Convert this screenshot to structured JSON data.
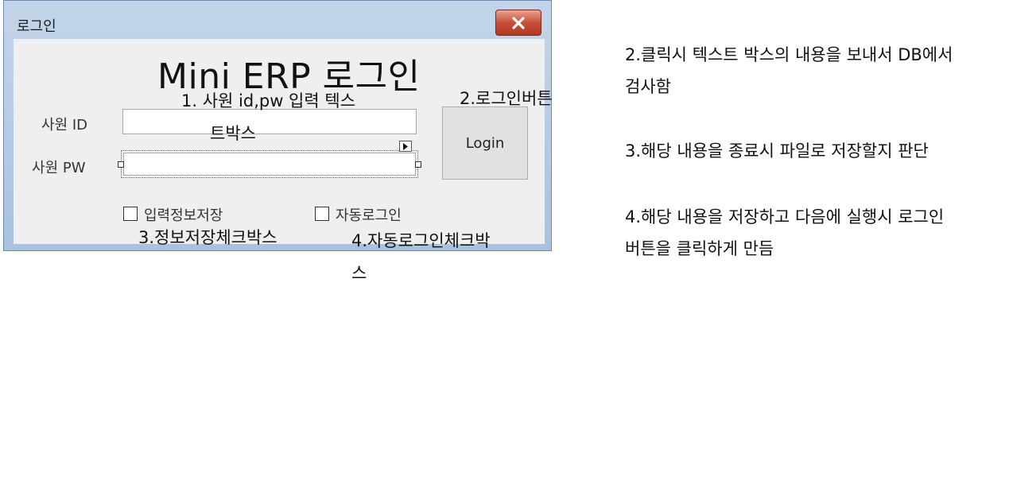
{
  "window": {
    "title": "로그인",
    "close_glyph": "×"
  },
  "form": {
    "heading": "Mini ERP 로그인",
    "id_label": "사원 ID",
    "pw_label": "사원 PW",
    "id_value": "",
    "pw_value": "",
    "login_button": "Login",
    "save_info_label": "입력정보저장",
    "auto_login_label": "자동로그인",
    "save_info_checked": false,
    "auto_login_checked": false
  },
  "annotations": {
    "textbox_note_line1": "1.   사원 id,pw 입력 텍스",
    "textbox_note_line2": "트박스",
    "button_note": "2.로그인버튼",
    "save_check_note": "3.정보저장체크박스",
    "auto_check_note_line1": "4.자동로그인체크박",
    "auto_check_note_line2": "스"
  },
  "notes": {
    "note2_line1": "2.클릭시 텍스트 박스의 내용을 보내서 DB에서",
    "note2_line2": "검사함",
    "note3": "3.해당 내용을 종료시 파일로 저장할지 판단",
    "note4_line1": "4.해당 내용을 저장하고 다음에 실행시 로그인",
    "note4_line2": "버튼을 클릭하게 만듬"
  },
  "icons": {
    "close": "close-icon",
    "smart_tag": "smart-tag-arrow-icon"
  },
  "colors": {
    "title_gradient_top": "#c3d5ea",
    "close_red": "#c7503a",
    "client_bg": "#efefef"
  }
}
